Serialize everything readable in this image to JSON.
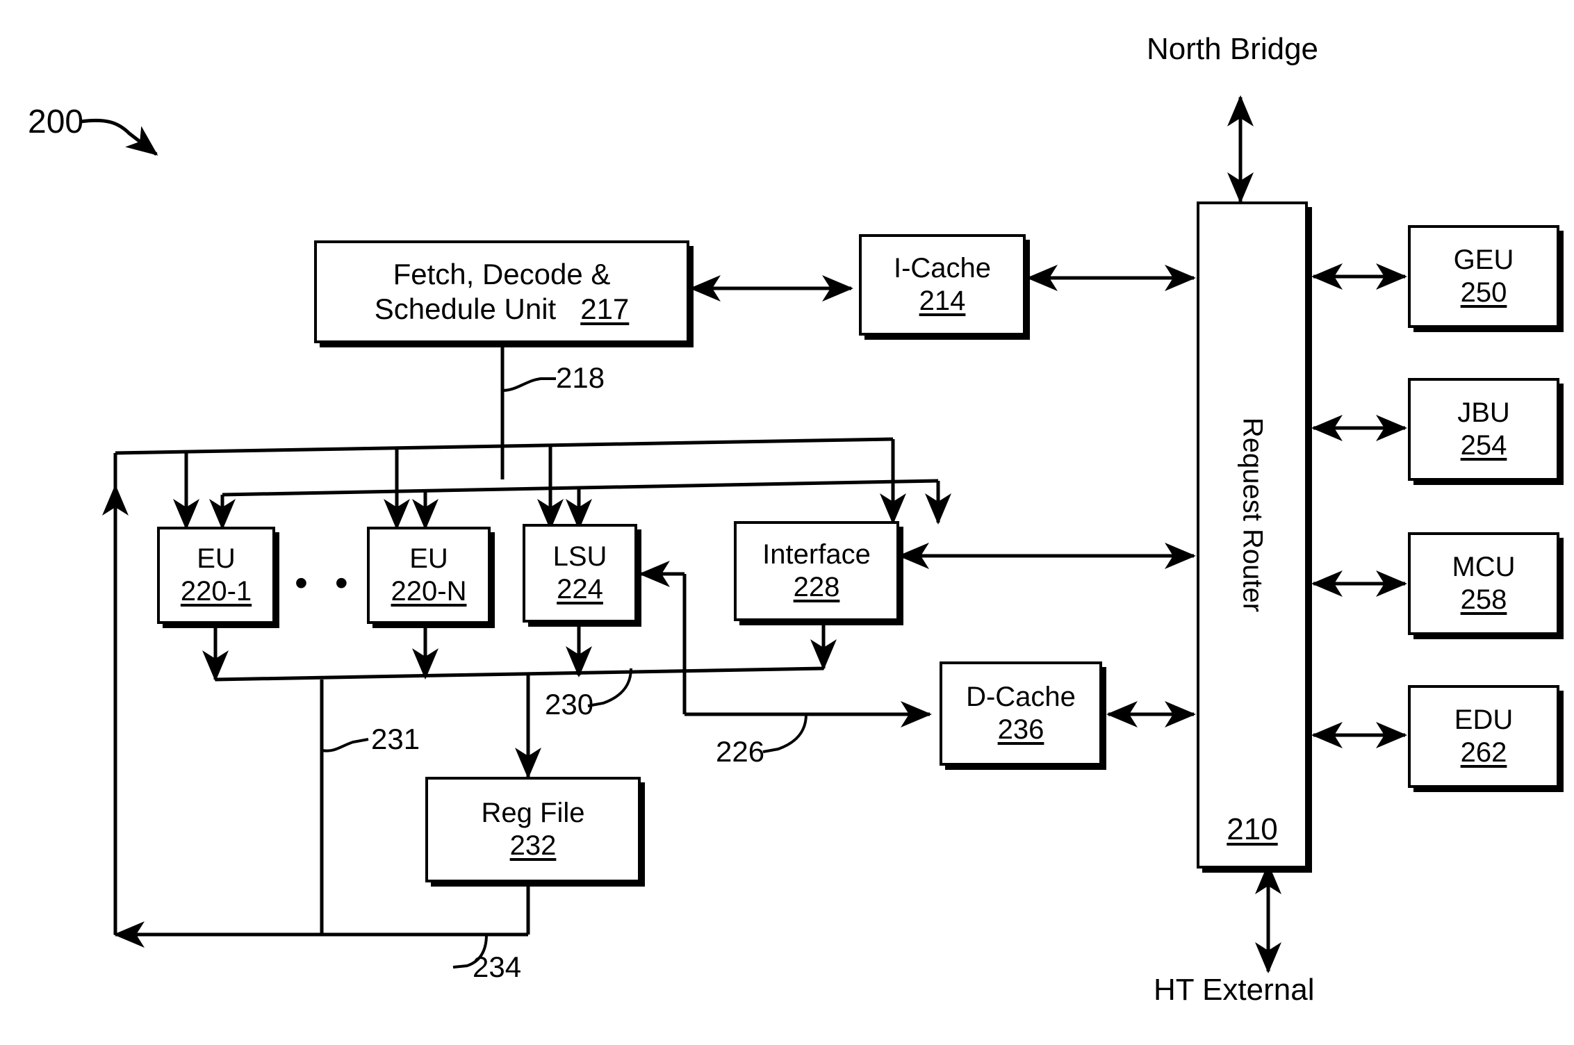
{
  "figure": {
    "tag": "200"
  },
  "external_labels": {
    "north_bridge": "North Bridge",
    "ht_external": "HT External"
  },
  "blocks": {
    "fetch_unit": {
      "name": "Fetch, Decode &",
      "name2": "Schedule Unit",
      "ref": "217"
    },
    "icache": {
      "name": "I-Cache",
      "ref": "214"
    },
    "router": {
      "name": "Request Router",
      "ref": "210"
    },
    "geu": {
      "name": "GEU",
      "ref": "250"
    },
    "jbu": {
      "name": "JBU",
      "ref": "254"
    },
    "mcu": {
      "name": "MCU",
      "ref": "258"
    },
    "edu": {
      "name": "EDU",
      "ref": "262"
    },
    "eu_first": {
      "name": "EU",
      "ref": "220-1"
    },
    "eu_last": {
      "name": "EU",
      "ref": "220-N"
    },
    "lsu": {
      "name": "LSU",
      "ref": "224"
    },
    "interface": {
      "name": "Interface",
      "ref": "228"
    },
    "reg_file": {
      "name": "Reg File",
      "ref": "232"
    },
    "dcache": {
      "name": "D-Cache",
      "ref": "236"
    }
  },
  "ellipsis": "• • •",
  "bus_refs": {
    "dispatch_bus": "218",
    "lsu_to_dcache": "226",
    "lsu_result": "230",
    "eu_result": "231",
    "writeback": "234"
  },
  "colors": {
    "ink": "#000000",
    "paper": "#ffffff"
  }
}
